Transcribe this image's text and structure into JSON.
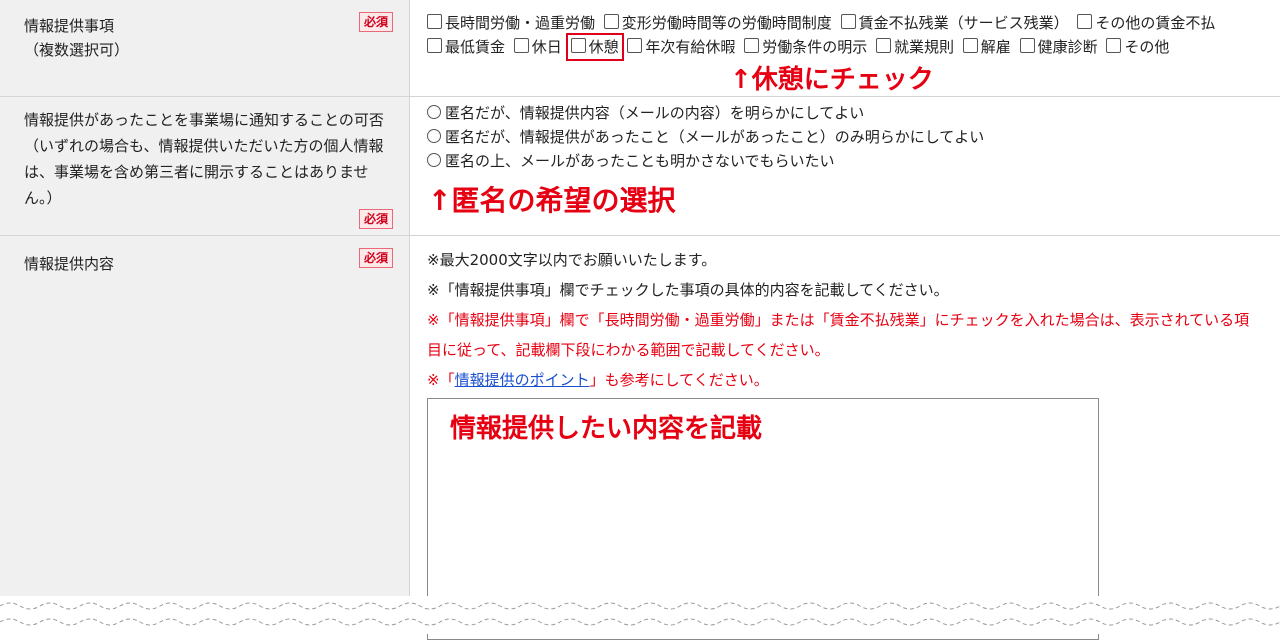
{
  "rows": {
    "info_items": {
      "label_line1": "情報提供事項",
      "label_line2": "（複数選択可）",
      "required": "必須",
      "options": [
        "長時間労働・過重労働",
        "変形労働時間等の労働時間制度",
        "賃金不払残業（サービス残業）",
        "その他の賃金不払",
        "最低賃金",
        "休日",
        "休憩",
        "年次有給休暇",
        "労働条件の明示",
        "就業規則",
        "解雇",
        "健康診断",
        "その他"
      ],
      "annotation": "↑休憩にチェック"
    },
    "notify": {
      "label": "情報提供があったことを事業場に通知することの可否（いずれの場合も、情報提供いただいた方の個人情報は、事業場を含め第三者に開示することはありません。）",
      "required": "必須",
      "options": [
        "匿名だが、情報提供内容（メールの内容）を明らかにしてよい",
        "匿名だが、情報提供があったこと（メールがあったこと）のみ明らかにしてよい",
        "匿名の上、メールがあったことも明かさないでもらいたい"
      ],
      "annotation": "↑匿名の希望の選択"
    },
    "content": {
      "label": "情報提供内容",
      "required": "必須",
      "note1": "※最大2000文字以内でお願いいたします。",
      "note2": "※「情報提供事項」欄でチェックした事項の具体的内容を記載してください。",
      "note3": "※「情報提供事項」欄で「長時間労働・過重労働」または「賃金不払残業」にチェックを入れた場合は、表示されている項目に従って、記載欄下段にわかる範囲で記載してください。",
      "note4_prefix": "※「",
      "note4_link": "情報提供のポイント",
      "note4_suffix": "」も参考にしてください。",
      "textarea_hint": "情報提供したい内容を記載"
    }
  }
}
